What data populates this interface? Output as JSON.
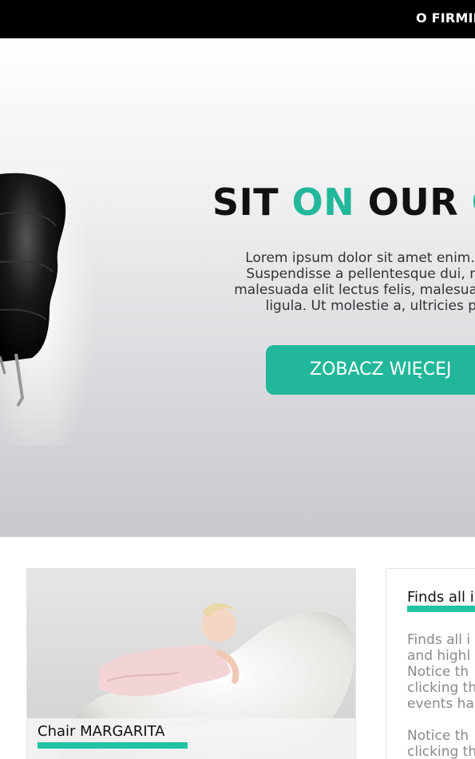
{
  "nav": {
    "items": [
      "O FIRMIE"
    ]
  },
  "hero": {
    "title_part1": "SIT ",
    "title_accent1": "ON",
    "title_part2": " OUR ",
    "title_accent2": "C",
    "paragraph_lines": [
      "Lorem ipsum dolor sit amet enim. Etia",
      "Suspendisse a pellentesque dui, non f",
      "malesuada elit lectus felis, malesuada ult",
      "ligula. Ut molestie a, ultricies po"
    ],
    "cta_label": "ZOBACZ WIĘCEJ"
  },
  "product": {
    "caption": "Chair MARGARITA"
  },
  "info": {
    "title": "Finds all i",
    "para1_lines": [
      "Finds all i",
      "and highl",
      "Notice th",
      "clicking th",
      "events ha"
    ],
    "para2_lines": [
      "Notice th",
      "clicking th"
    ]
  },
  "colors": {
    "accent": "#22b79a",
    "nav_bg": "#000000"
  }
}
